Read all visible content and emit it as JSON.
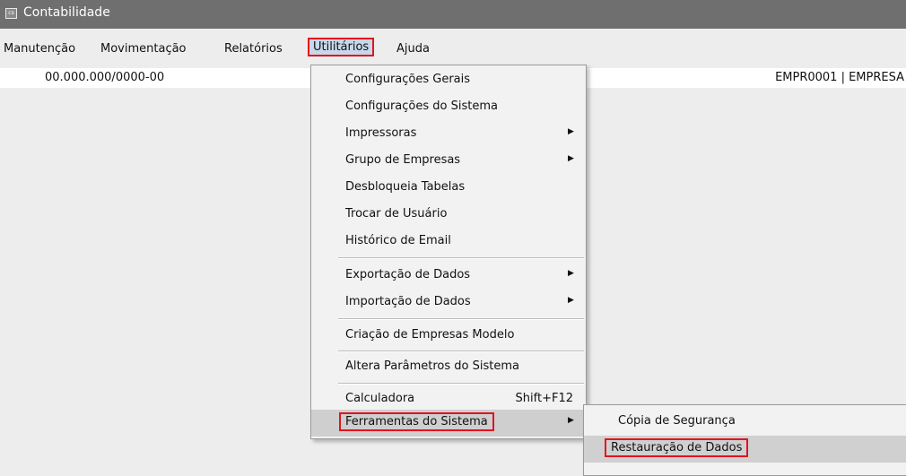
{
  "window": {
    "title": "Contabilidade",
    "icon": "app-window-icon"
  },
  "menubar": {
    "items": [
      {
        "label": "Manutenção"
      },
      {
        "label": "Movimentação"
      },
      {
        "label": "Relatórios"
      },
      {
        "label": "Utilitários"
      },
      {
        "label": "Ajuda"
      }
    ]
  },
  "info": {
    "cnpj": "00.000.000/0000-00",
    "empresa": "EMPR0001 | EMPRESA"
  },
  "dropdown": {
    "items": [
      {
        "label": "Configurações Gerais"
      },
      {
        "label": "Configurações do Sistema"
      },
      {
        "label": "Impressoras",
        "arrow": "▶"
      },
      {
        "label": "Grupo de Empresas",
        "arrow": "▶"
      },
      {
        "label": "Desbloqueia Tabelas"
      },
      {
        "label": "Trocar de Usuário"
      },
      {
        "label": "Histórico de Email"
      },
      {
        "label": "Exportação de Dados",
        "arrow": "▶"
      },
      {
        "label": "Importação de Dados",
        "arrow": "▶"
      },
      {
        "label": "Criação de Empresas Modelo"
      },
      {
        "label": "Altera Parâmetros do Sistema"
      },
      {
        "label": "Calculadora",
        "shortcut": "Shift+F12"
      },
      {
        "label": "Ferramentas do Sistema",
        "arrow": "▶"
      }
    ]
  },
  "submenu": {
    "items": [
      {
        "label": "Cópia de Segurança"
      },
      {
        "label": "Restauração de Dados"
      }
    ]
  },
  "colors": {
    "highlight": "#e1141f",
    "titlebar": "#6f6f6f",
    "menu_bg": "#f2f2f2"
  }
}
